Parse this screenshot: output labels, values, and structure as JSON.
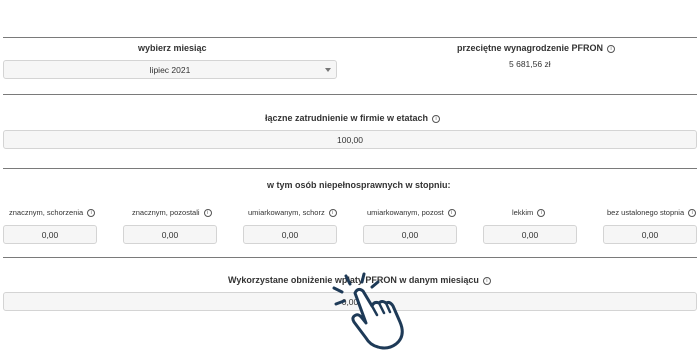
{
  "month": {
    "label": "wybierz miesiąc",
    "selected": "lipiec 2021"
  },
  "salary": {
    "label": "przeciętne wynagrodzenie PFRON",
    "value": "5 681,56 zł"
  },
  "employment": {
    "label": "łączne zatrudnienie w firmie w etatach",
    "value": "100,00"
  },
  "disabled": {
    "label": "w tym osób niepełnosprawnych w stopniu:",
    "fields": [
      {
        "label": "znacznym, schorzenia",
        "value": "0,00"
      },
      {
        "label": "znacznym, pozostali",
        "value": "0,00"
      },
      {
        "label": "umiarkowanym, schorz",
        "value": "0,00"
      },
      {
        "label": "umiarkowanym, pozost",
        "value": "0,00"
      },
      {
        "label": "lekkim",
        "value": "0,00"
      },
      {
        "label": "bez ustalonego stopnia",
        "value": "0,00"
      }
    ]
  },
  "reduction": {
    "label": "Wykorzystane obniżenie wpłaty PFRON w danym miesiącu",
    "value": "0,00"
  },
  "icons": {
    "info": "info-icon",
    "dropdown": "chevron-down-icon",
    "pointer": "hand-pointer-click-icon"
  },
  "colors": {
    "hand": "#1e3a57",
    "border": "#d4d4d4",
    "field_bg": "#f6f6f6"
  }
}
